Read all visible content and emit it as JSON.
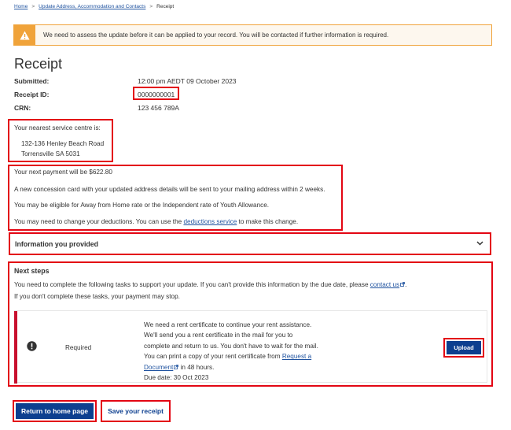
{
  "breadcrumb": {
    "home": "Home",
    "parent": "Update Address, Accommodation and Contacts",
    "sep": ">",
    "current": "Receipt"
  },
  "alert": {
    "icon": "warning-icon",
    "message": "We need to assess the update before it can be applied to your record. You will be contacted if further information is required."
  },
  "receipt": {
    "title": "Receipt",
    "submitted_label": "Submitted:",
    "submitted_value": "12:00 pm AEDT 09 October 2023",
    "receipt_id_label": "Receipt ID:",
    "receipt_id_value": "0000000001",
    "crn_label": "CRN:",
    "crn_value": "123 456 789A"
  },
  "service_centre": {
    "intro": "Your nearest service centre is:",
    "address_line1": "132-136 Henley Beach Road",
    "address_line2": "Torrensville SA 5031"
  },
  "payment_info": {
    "next_payment": "Your next payment will be $622.80",
    "concession": "A new concession card with your updated address details will be sent to your mailing address within 2 weeks.",
    "eligibility": "You may be eligible for Away from Home rate or the Independent rate of Youth Allowance.",
    "deductions_prefix": "You may need to change your deductions. You can use the ",
    "deductions_link": "deductions service",
    "deductions_suffix": " to make this change."
  },
  "accordion": {
    "title": "Information you provided",
    "icon": "chevron-down-icon"
  },
  "next_steps": {
    "title": "Next steps",
    "intro_prefix": "You need to complete the following tasks to support your update. If you can't provide this information by the due date, please ",
    "contact_link": "contact us",
    "intro_suffix": ".",
    "intro_line2": "If you don't complete these tasks, your payment may stop.",
    "task": {
      "status": "Required",
      "status_icon": "exclamation-circle-icon",
      "line1": "We need a rent certificate to continue your rent assistance.",
      "line2": "We'll send you a rent certificate in the mail for you to",
      "line3": "complete and return to us. You don't have to wait for the mail.",
      "line4_prefix": "You can print a copy of your rent certificate from ",
      "link_part1": "Request a",
      "link_part2": "Document",
      "line5_suffix": " in 48 hours.",
      "due": "Due date: 30 Oct 2023",
      "upload_label": "Upload"
    }
  },
  "actions": {
    "home_label": "Return to home page",
    "save_label": "Save your receipt"
  },
  "colors": {
    "accent_red": "#e30613",
    "primary_blue": "#0d3f8f",
    "warning_orange": "#f0a33a",
    "task_bar": "#c8102e"
  }
}
